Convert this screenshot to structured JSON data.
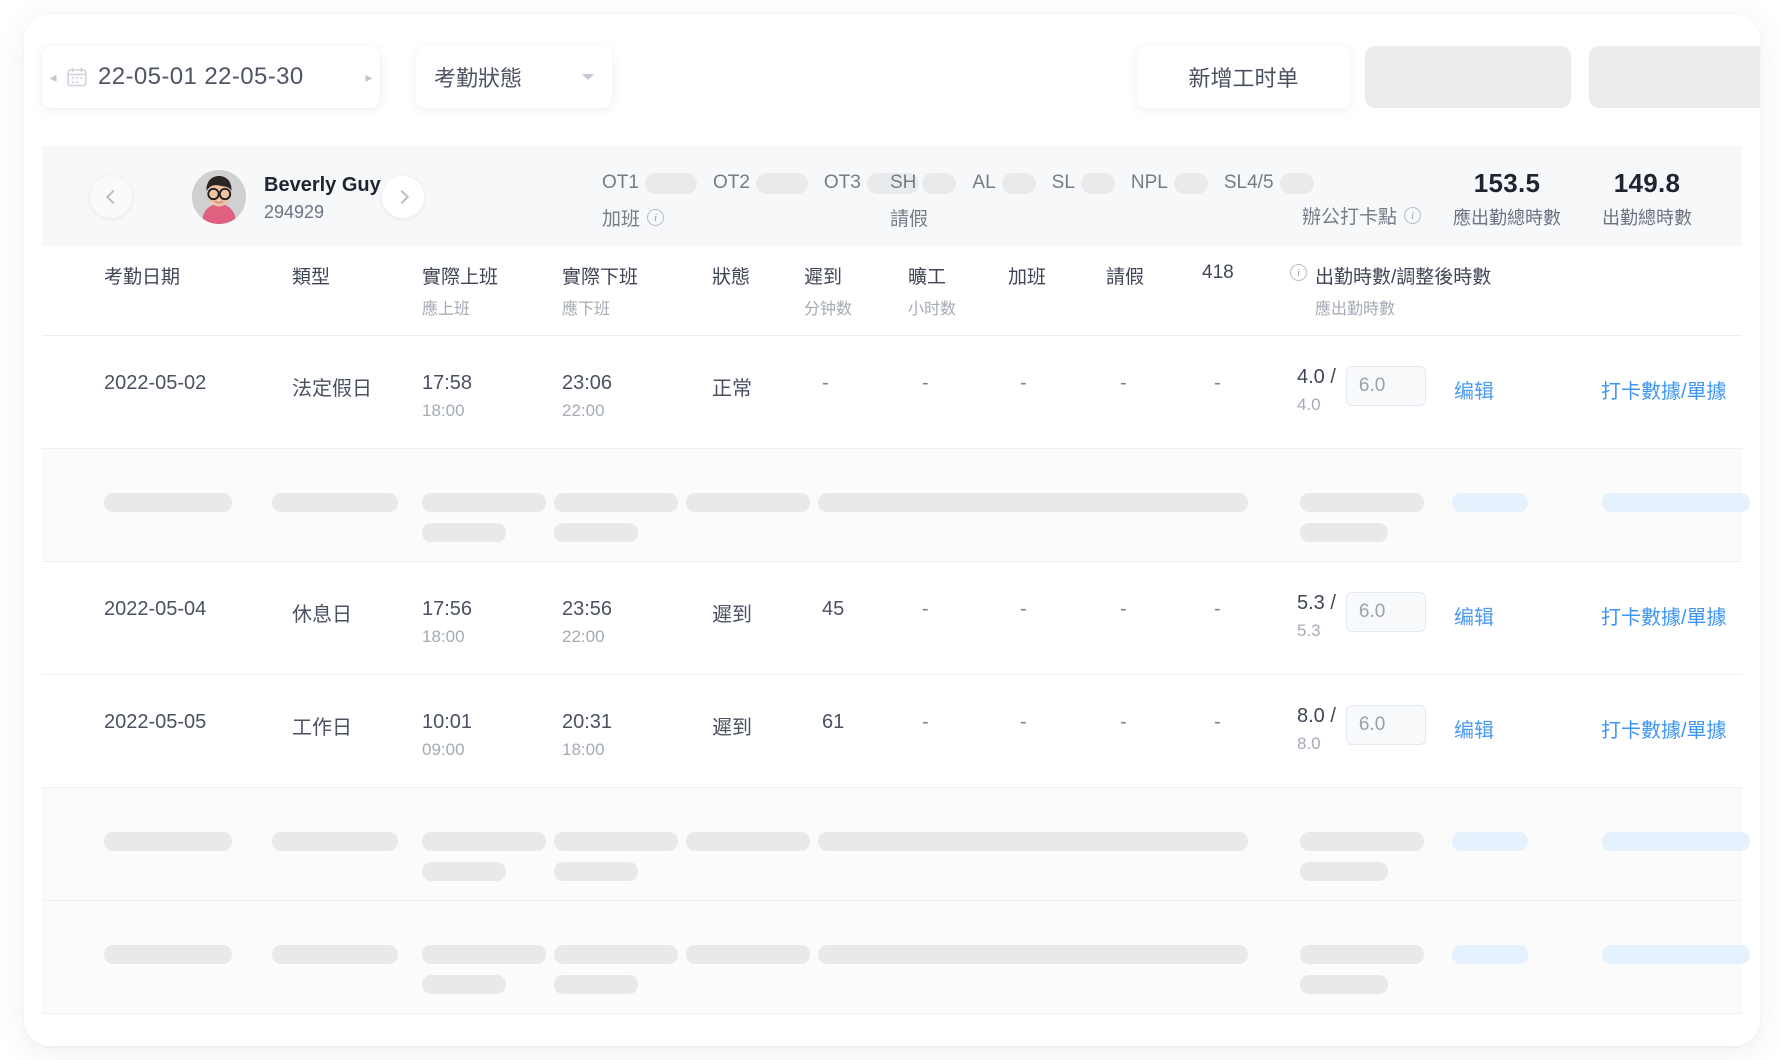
{
  "toolbar": {
    "date_range": "22-05-01 22-05-30",
    "prev_arrow": "◂",
    "next_arrow": "▸",
    "calendar_icon": "calendar-icon",
    "status_filter_label": "考勤狀態",
    "add_timesheet_label": "新增工时单"
  },
  "summary": {
    "employee_name": "Beverly Guy",
    "employee_id": "294929",
    "overtime": {
      "group_label": "加班",
      "items": [
        {
          "label": "OT1"
        },
        {
          "label": "OT2"
        },
        {
          "label": "OT3"
        }
      ]
    },
    "leave": {
      "group_label": "請假",
      "items": [
        {
          "label": "SH"
        },
        {
          "label": "AL"
        },
        {
          "label": "SL"
        },
        {
          "label": "NPL"
        },
        {
          "label": "SL4/5"
        }
      ]
    },
    "punch_point_label": "辦公打卡點",
    "stats": [
      {
        "value": "153.5",
        "label": "應出勤總時數"
      },
      {
        "value": "149.8",
        "label": "出勤總時數"
      }
    ]
  },
  "table": {
    "headers": [
      {
        "title": "考勤日期",
        "sub": ""
      },
      {
        "title": "類型",
        "sub": ""
      },
      {
        "title": "實際上班",
        "sub": "應上班"
      },
      {
        "title": "實際下班",
        "sub": "應下班"
      },
      {
        "title": "狀態",
        "sub": ""
      },
      {
        "title": "遲到",
        "sub": "分钟数"
      },
      {
        "title": "曠工",
        "sub": "小时数"
      },
      {
        "title": "加班",
        "sub": ""
      },
      {
        "title": "請假",
        "sub": ""
      },
      {
        "title": "418",
        "sub": ""
      },
      {
        "title": "出勤時數/調整後時數",
        "sub": "應出勤時數"
      }
    ],
    "rows": [
      {
        "type": "data",
        "date": "2022-05-02",
        "day_type": "法定假日",
        "actual_in": "17:58",
        "scheduled_in": "18:00",
        "actual_out": "23:06",
        "scheduled_out": "22:00",
        "status": "正常",
        "late": "-",
        "absent": "-",
        "overtime": "-",
        "leave": "-",
        "c418": "-",
        "hours": "4.0 /",
        "hours_sub": "4.0",
        "adjust_value": "6.0",
        "edit_label": "编辑",
        "punch_label": "打卡數據/單據"
      },
      {
        "type": "skeleton"
      },
      {
        "type": "data",
        "date": "2022-05-04",
        "day_type": "休息日",
        "actual_in": "17:56",
        "scheduled_in": "18:00",
        "actual_out": "23:56",
        "scheduled_out": "22:00",
        "status": "遲到",
        "late": "45",
        "absent": "-",
        "overtime": "-",
        "leave": "-",
        "c418": "-",
        "hours": "5.3 /",
        "hours_sub": "5.3",
        "adjust_value": "6.0",
        "edit_label": "编辑",
        "punch_label": "打卡數據/單據"
      },
      {
        "type": "data",
        "date": "2022-05-05",
        "day_type": "工作日",
        "actual_in": "10:01",
        "scheduled_in": "09:00",
        "actual_out": "20:31",
        "scheduled_out": "18:00",
        "status": "遲到",
        "late": "61",
        "absent": "-",
        "overtime": "-",
        "leave": "-",
        "c418": "-",
        "hours": "8.0 /",
        "hours_sub": "8.0",
        "adjust_value": "6.0",
        "edit_label": "编辑",
        "punch_label": "打卡數據/單據"
      },
      {
        "type": "skeleton"
      },
      {
        "type": "skeleton"
      }
    ]
  },
  "colors": {
    "link_blue": "#3d96f7",
    "skeleton_grey": "#e9e9eb",
    "skeleton_blue": "#e5f1fd",
    "summary_bg": "#f7f8f9"
  }
}
